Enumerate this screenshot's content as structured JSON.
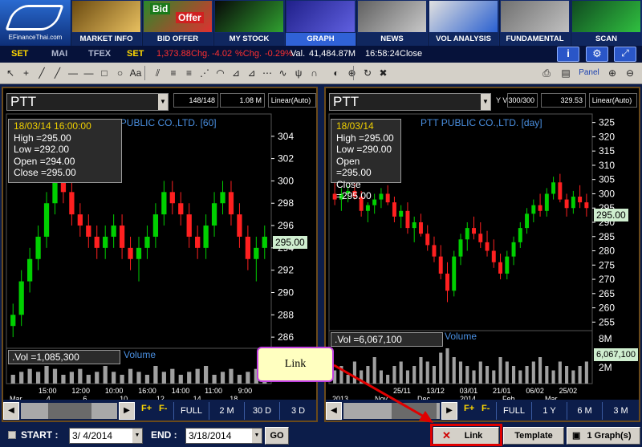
{
  "logo": {
    "text": "EFinanceThai.com"
  },
  "nav": [
    {
      "label": "MARKET INFO",
      "icon": "coins-icon"
    },
    {
      "label": "BID OFFER",
      "icon": "bid-offer-icon",
      "badges": [
        "Bid",
        "Offer"
      ]
    },
    {
      "label": "MY STOCK",
      "icon": "stock-board-icon"
    },
    {
      "label": "GRAPH",
      "icon": "graph-icon",
      "active": true
    },
    {
      "label": "NEWS",
      "icon": "news-icon"
    },
    {
      "label": "VOL ANALYSIS",
      "icon": "bar-chart-icon"
    },
    {
      "label": "FUNDAMENTAL",
      "icon": "fundamental-icon"
    },
    {
      "label": "SCAN",
      "icon": "globe-icon"
    }
  ],
  "market": {
    "tabs": [
      "SET",
      "MAI",
      "TFEX"
    ],
    "index_label": "SET",
    "index_value": "1,373.88",
    "chg_label": "Chg.",
    "chg": "-4.02",
    "pchg_label": "%Chg.",
    "pchg": "-0.29%",
    "vol_label": "Val.",
    "vol": "41,484.87M",
    "time": "16:58:24",
    "status": "Close"
  },
  "toolbar": {
    "tools": [
      "cursor-icon",
      "crosshair-icon",
      "trendline-icon",
      "ray-icon",
      "hline-icon",
      "hline-icon",
      "rectangle-icon",
      "circle-icon",
      "text-icon",
      "channel-icon",
      "fib-icon",
      "fib-icon",
      "gann-icon",
      "arc-icon",
      "fan-icon",
      "fib-fan-icon",
      "speed-line-icon",
      "cycle-icon",
      "pitchfork-icon",
      "magnet-icon",
      "color-icon",
      "zoom-icon",
      "refresh-icon",
      "delete-icon"
    ],
    "right": [
      "print-icon",
      "save-icon"
    ],
    "panel_label": "Panel"
  },
  "left": {
    "symbol": "PTT",
    "stat1": "148/148",
    "stat2": "1.08 M",
    "scale": "Linear(Auto)",
    "title": "PTT PUBLIC CO.,LTD. [60]",
    "info": {
      "date": "18/03/14 16:00:00",
      "high": "High  =295.00",
      "low": "Low   =292.00",
      "open": "Open  =294.00",
      "close": "Close =295.00"
    },
    "y_ticks": [
      "304",
      "302",
      "300",
      "298",
      "296",
      "294",
      "292",
      "290",
      "288",
      "286"
    ],
    "last": "295.00",
    "vol": ".Vol   =1,085,300",
    "vol_title": "Volume",
    "x_top": [
      "15:00",
      "12:00",
      "10:00",
      "16:00",
      "14:00",
      "11:00",
      "9:00"
    ],
    "x_bot": [
      "Mar",
      "4",
      "6",
      "10",
      "12",
      "14",
      "18"
    ],
    "ranges": [
      "FULL",
      "2 M",
      "30 D",
      "3 D"
    ],
    "chart_data": {
      "type": "candlestick",
      "ylim": [
        285,
        306
      ],
      "candles": [
        [
          287,
          289,
          286,
          288
        ],
        [
          288,
          292,
          287,
          291
        ],
        [
          291,
          294,
          290,
          293
        ],
        [
          293,
          296,
          292,
          295
        ],
        [
          295,
          299,
          294,
          298
        ],
        [
          298,
          301,
          297,
          300
        ],
        [
          300,
          302,
          298,
          299
        ],
        [
          299,
          300,
          296,
          297
        ],
        [
          297,
          298,
          295,
          296
        ],
        [
          296,
          297,
          294,
          295
        ],
        [
          295,
          296,
          293,
          294
        ],
        [
          294,
          296,
          293,
          295
        ],
        [
          295,
          297,
          294,
          296
        ],
        [
          296,
          297,
          293,
          294
        ],
        [
          294,
          295,
          292,
          293
        ],
        [
          293,
          295,
          291,
          294
        ],
        [
          294,
          296,
          293,
          295
        ],
        [
          295,
          298,
          294,
          297
        ],
        [
          297,
          300,
          296,
          299
        ],
        [
          299,
          300,
          297,
          298
        ],
        [
          298,
          299,
          296,
          297
        ],
        [
          297,
          298,
          294,
          295
        ],
        [
          295,
          296,
          293,
          294
        ],
        [
          294,
          297,
          293,
          296
        ],
        [
          296,
          299,
          295,
          298
        ],
        [
          298,
          300,
          297,
          299
        ],
        [
          299,
          300,
          296,
          297
        ],
        [
          297,
          298,
          294,
          295
        ],
        [
          295,
          296,
          292,
          293
        ],
        [
          293,
          295,
          291,
          294
        ],
        [
          294,
          296,
          293,
          295
        ]
      ],
      "volume": [
        3,
        4,
        5,
        4,
        6,
        5,
        3,
        4,
        5,
        3,
        4,
        6,
        4,
        3,
        5,
        4,
        3,
        6,
        4,
        5,
        3,
        4,
        5,
        6,
        3,
        4,
        5,
        3,
        4,
        5,
        6
      ]
    }
  },
  "right": {
    "symbol": "PTT",
    "scale": "Linear(Auto)",
    "yv": "Y V",
    "stat1": "300/300",
    "stat2": "329.53",
    "title": "PTT PUBLIC CO.,LTD. [day]",
    "info": {
      "date": "18/03/14",
      "high": "High  =295.00",
      "low": "Low   =290.00",
      "open": "Open  =295.00",
      "close": "Close =295.00"
    },
    "y_ticks": [
      "325",
      "320",
      "315",
      "310",
      "305",
      "300",
      "295",
      "290",
      "285",
      "280",
      "275",
      "270",
      "265",
      "260",
      "255"
    ],
    "last": "295.00",
    "vol": ".Vol   =6,067,100",
    "vol_title": "Volume",
    "vol_ticks": [
      "8M",
      "6,067,100",
      "2M"
    ],
    "x_top": [
      "25/11",
      "13/12",
      "03/01",
      "21/01",
      "06/02",
      "25/02"
    ],
    "x_bot": [
      "2013",
      "Nov",
      "Dec",
      "2014",
      "Feb",
      "Mar"
    ],
    "ranges": [
      "FULL",
      "1 Y",
      "6 M",
      "3 M"
    ],
    "chart_data": {
      "type": "candlestick",
      "ylim": [
        252,
        328
      ],
      "candles": [
        [
          300,
          304,
          296,
          298
        ],
        [
          298,
          302,
          294,
          300
        ],
        [
          300,
          303,
          297,
          301
        ],
        [
          301,
          305,
          298,
          299
        ],
        [
          299,
          301,
          292,
          294
        ],
        [
          294,
          297,
          290,
          296
        ],
        [
          296,
          300,
          293,
          298
        ],
        [
          298,
          302,
          295,
          300
        ],
        [
          300,
          303,
          296,
          297
        ],
        [
          297,
          299,
          290,
          292
        ],
        [
          292,
          296,
          288,
          294
        ],
        [
          294,
          297,
          286,
          288
        ],
        [
          288,
          292,
          283,
          290
        ],
        [
          290,
          293,
          285,
          286
        ],
        [
          286,
          289,
          280,
          282
        ],
        [
          282,
          285,
          276,
          278
        ],
        [
          278,
          282,
          270,
          272
        ],
        [
          272,
          276,
          262,
          266
        ],
        [
          266,
          280,
          264,
          278
        ],
        [
          278,
          286,
          275,
          284
        ],
        [
          284,
          290,
          280,
          288
        ],
        [
          288,
          292,
          284,
          286
        ],
        [
          286,
          290,
          281,
          283
        ],
        [
          283,
          287,
          278,
          280
        ],
        [
          280,
          284,
          274,
          276
        ],
        [
          276,
          279,
          270,
          272
        ],
        [
          272,
          280,
          270,
          278
        ],
        [
          278,
          285,
          275,
          283
        ],
        [
          283,
          290,
          281,
          288
        ],
        [
          288,
          295,
          286,
          293
        ],
        [
          293,
          298,
          290,
          296
        ],
        [
          296,
          300,
          292,
          294
        ],
        [
          294,
          302,
          292,
          300
        ],
        [
          300,
          306,
          298,
          304
        ],
        [
          304,
          307,
          297,
          298
        ],
        [
          298,
          300,
          292,
          295
        ],
        [
          295,
          301,
          293,
          299
        ],
        [
          299,
          303,
          295,
          297
        ],
        [
          297,
          300,
          292,
          295
        ]
      ],
      "volume": [
        3,
        4,
        2,
        5,
        3,
        4,
        6,
        3,
        2,
        4,
        5,
        3,
        4,
        6,
        5,
        4,
        7,
        8,
        6,
        5,
        4,
        3,
        5,
        4,
        3,
        6,
        5,
        4,
        3,
        4,
        5,
        6,
        4,
        3,
        5,
        4,
        3,
        4,
        5
      ]
    }
  },
  "bottom": {
    "start_label": "START :",
    "start": "3/ 4/2014",
    "end_label": "END :",
    "end": "3/18/2014",
    "go": "GO",
    "link": "Link",
    "template": "Template",
    "graphs": "1 Graph(s)"
  },
  "callout": {
    "text": "Link"
  }
}
